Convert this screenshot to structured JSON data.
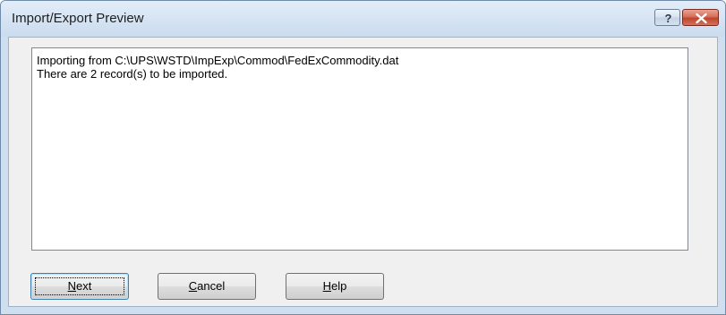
{
  "window": {
    "title": "Import/Export Preview",
    "help_button_glyph": "?",
    "close_button_glyph": "✕",
    "help_icon": "question-mark-icon",
    "close_icon": "close-icon",
    "close_color": "#c7492f"
  },
  "preview": {
    "lines": [
      "Importing from C:\\UPS\\WSTD\\ImpExp\\Commod\\FedExCommodity.dat",
      "There are 2 record(s) to be imported."
    ]
  },
  "buttons": {
    "next": {
      "accel": "N",
      "rest": "ext"
    },
    "cancel": {
      "accel": "C",
      "rest": "ancel"
    },
    "help": {
      "accel": "H",
      "rest": "elp"
    }
  }
}
